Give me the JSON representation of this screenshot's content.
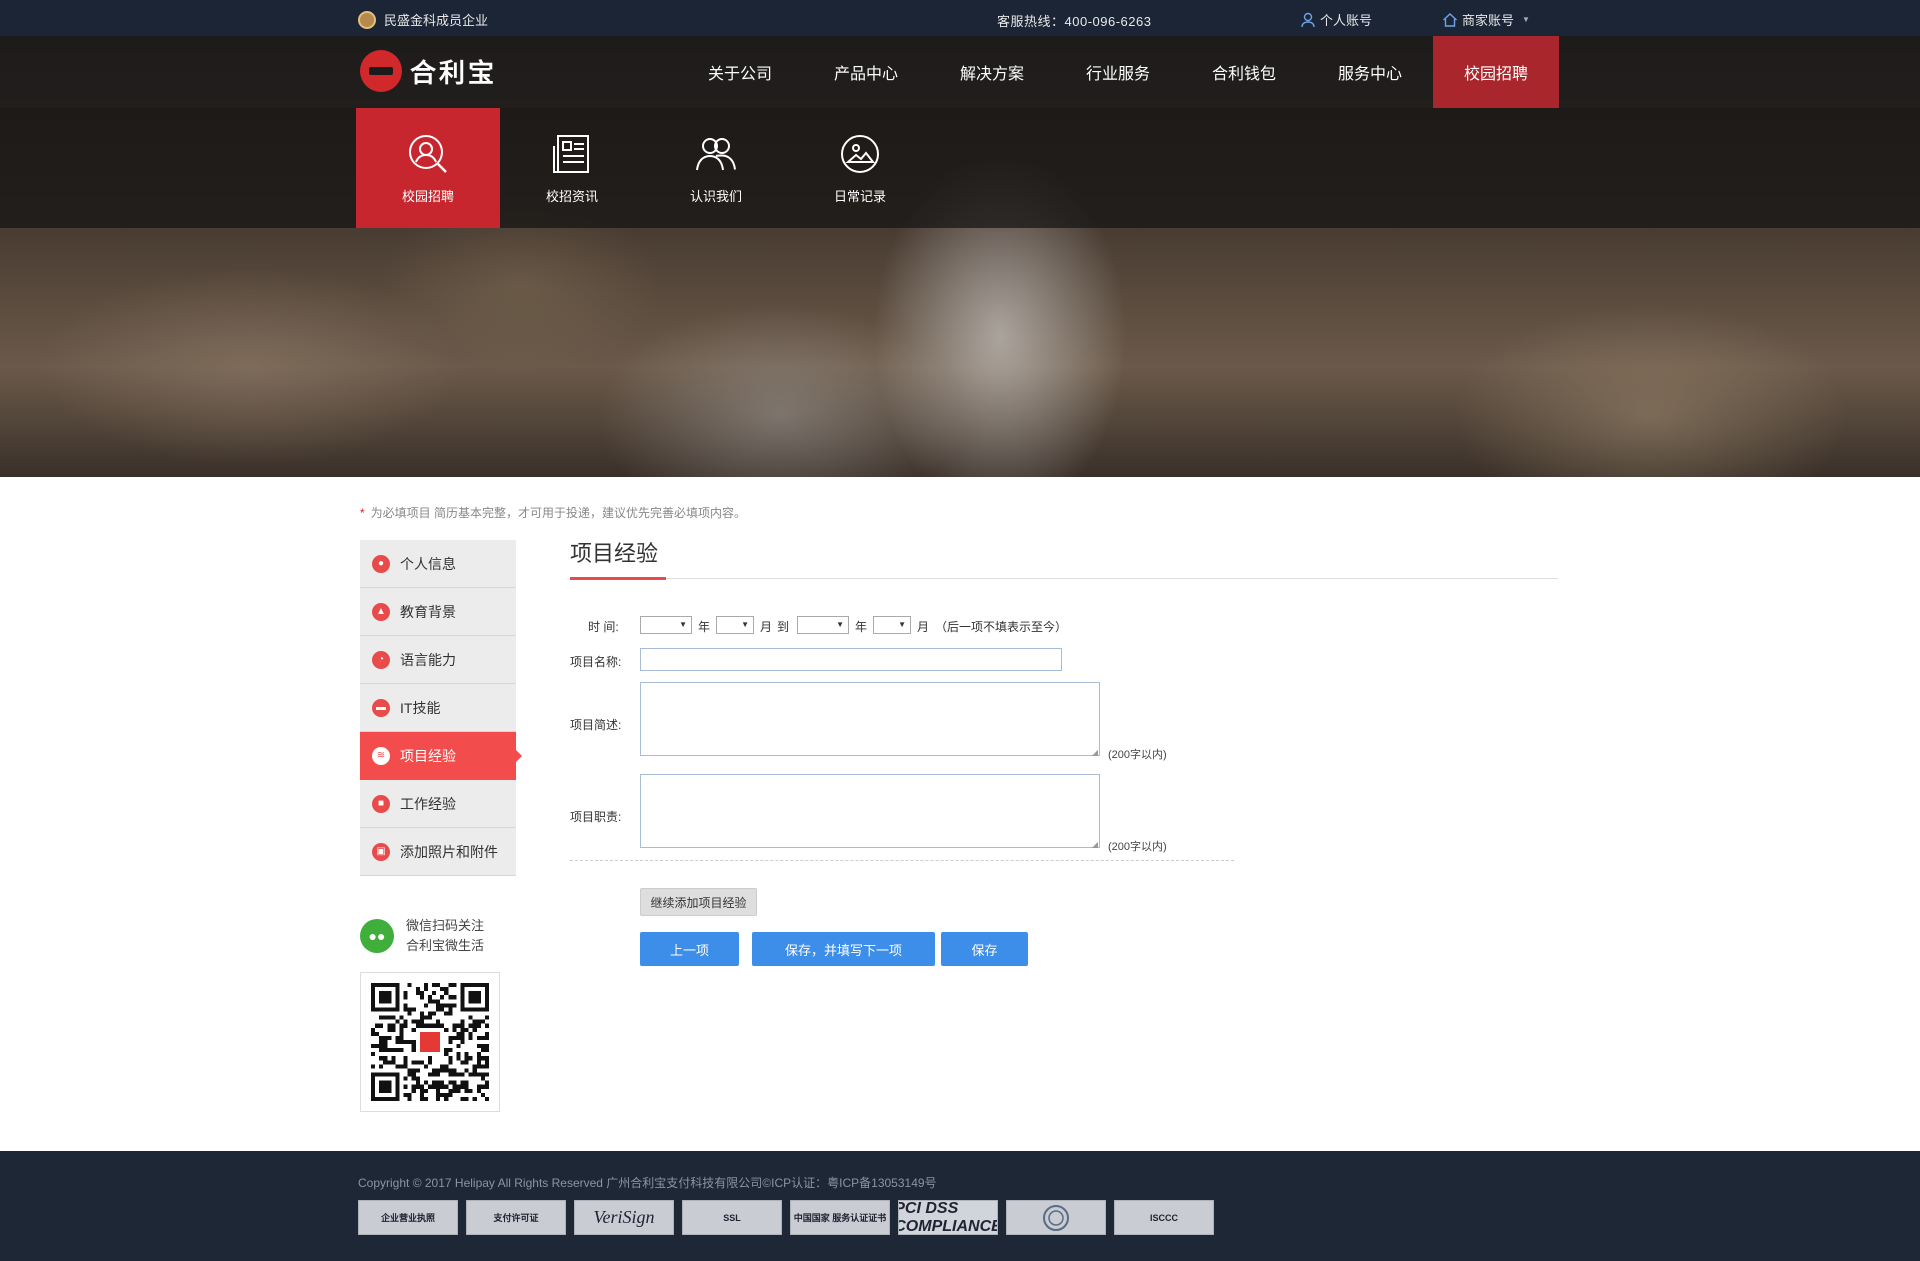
{
  "topbar": {
    "enterprise": "民盛金科成员企业",
    "hotline": "客服热线：400-096-6263",
    "personal_account": "个人账号",
    "merchant_account": "商家账号"
  },
  "brand": {
    "name": "合利宝"
  },
  "nav": {
    "items": [
      "关于公司",
      "产品中心",
      "解决方案",
      "行业服务",
      "合利钱包",
      "服务中心",
      "校园招聘"
    ],
    "active": "校园招聘"
  },
  "subnav": {
    "items": [
      {
        "label": "校园招聘",
        "icon": "search-person-icon"
      },
      {
        "label": "校招资讯",
        "icon": "news-icon"
      },
      {
        "label": "认识我们",
        "icon": "people-icon"
      },
      {
        "label": "日常记录",
        "icon": "photo-icon"
      }
    ]
  },
  "notice": {
    "star": "*",
    "text": "为必填项目 简历基本完整，才可用于投递，建议优先完善必填项内容。"
  },
  "sidebar": {
    "items": [
      {
        "label": "个人信息",
        "icon": "person-icon"
      },
      {
        "label": "教育背景",
        "icon": "graduation-cap-icon"
      },
      {
        "label": "语言能力",
        "icon": "language-icon"
      },
      {
        "label": "IT技能",
        "icon": "monitor-icon"
      },
      {
        "label": "项目经验",
        "icon": "layers-icon"
      },
      {
        "label": "工作经验",
        "icon": "briefcase-icon"
      },
      {
        "label": "添加照片和附件",
        "icon": "image-icon"
      }
    ],
    "active": "项目经验"
  },
  "wechat": {
    "line1": "微信扫码关注",
    "line2": "合利宝微生活"
  },
  "form": {
    "title": "项目经验",
    "time_label": "时  间:",
    "year": "年",
    "month": "月",
    "to": "到",
    "time_note": "（后一项不填表示至今）",
    "name_label": "项目名称:",
    "desc_label": "项目简述:",
    "duty_label": "项目职责:",
    "limit_hint": "(200字以内)",
    "add_more": "继续添加项目经验",
    "prev": "上一项",
    "save_next": "保存，并填写下一项",
    "save": "保存"
  },
  "footer": {
    "copyright": "Copyright © 2017 Helipay All Rights Reserved    广州合利宝支付科技有限公司©ICP认证：粤ICP备13053149号",
    "badges": [
      "企业营业执照",
      "支付许可证",
      "VeriSign",
      "SSL",
      "中国国家 服务认证证书",
      "PCI DSS COMPLIANCE",
      "",
      "ISCCC"
    ]
  },
  "colors": {
    "brand_red": "#c8262e",
    "active_side": "#f24c4c",
    "button_blue": "#3d8ee8",
    "dark_bar": "#1b2535"
  }
}
